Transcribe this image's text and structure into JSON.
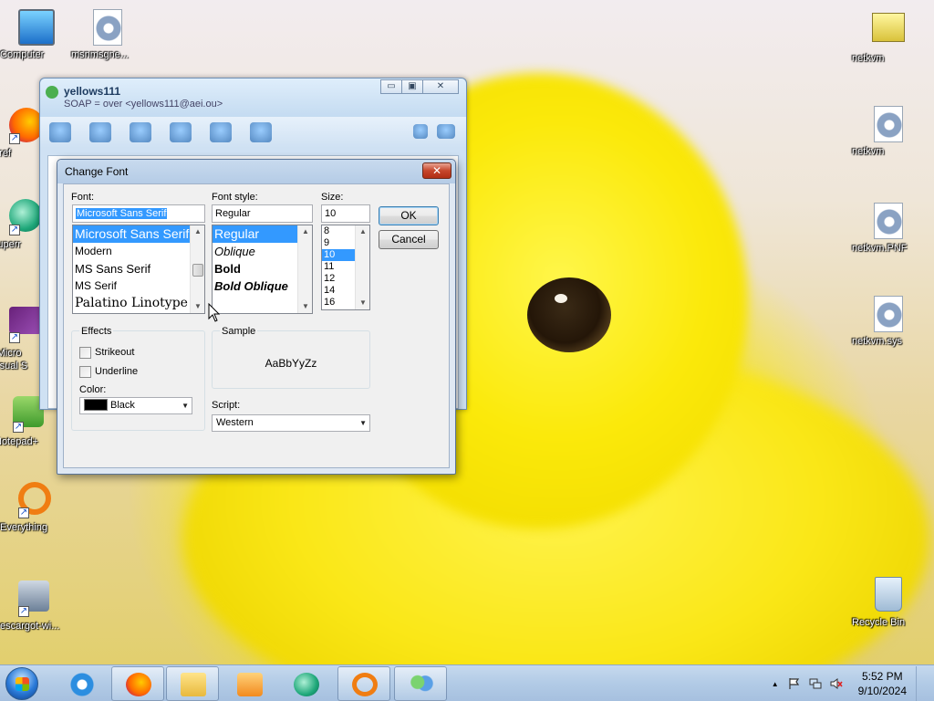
{
  "desktop": {
    "icons_left": [
      {
        "label": "Computer",
        "icon": "computer-icon"
      },
      {
        "label": "msnmsgne...",
        "icon": "gear-file-icon"
      },
      {
        "label": "Firef",
        "icon": "firefox-icon"
      },
      {
        "label": "Superr",
        "icon": "green-app-icon"
      },
      {
        "label": "Micro\nVisual S",
        "icon": "visual-studio-icon"
      },
      {
        "label": "Notepad+",
        "icon": "notepad-icon"
      },
      {
        "label": "Everything",
        "icon": "everything-icon"
      },
      {
        "label": "escargot-wi...",
        "icon": "installer-icon"
      }
    ],
    "icons_right": [
      {
        "label": "netkvm",
        "icon": "printer-icon"
      },
      {
        "label": "netkvm",
        "icon": "gear-file-icon"
      },
      {
        "label": "netkvm.PNF",
        "icon": "gear-file-icon"
      },
      {
        "label": "netkvm.sys",
        "icon": "gear-file-icon"
      },
      {
        "label": "Recycle Bin",
        "icon": "recycle-bin-icon"
      }
    ]
  },
  "messenger": {
    "title": "yellows111",
    "subtitle": "SOAP = over <yellows111@aei.ou>",
    "buttons": {
      "minimize": "▭",
      "maximize": "▣",
      "close": "✕"
    }
  },
  "dialog": {
    "title": "Change Font",
    "close_label": "✕",
    "font": {
      "label": "Font:",
      "value": "Microsoft Sans Serif",
      "items": [
        "Microsoft Sans Serif",
        "Modern",
        "MS Sans Serif",
        "MS Serif",
        "Palatino Linotype"
      ],
      "selected_index": 0
    },
    "font_style": {
      "label": "Font style:",
      "value": "Regular",
      "items": [
        "Regular",
        "Oblique",
        "Bold",
        "Bold Oblique"
      ],
      "selected_index": 0
    },
    "size": {
      "label": "Size:",
      "value": "10",
      "items": [
        "8",
        "9",
        "10",
        "11",
        "12",
        "14",
        "16"
      ],
      "selected_index": 2
    },
    "ok_label": "OK",
    "cancel_label": "Cancel",
    "effects": {
      "title": "Effects",
      "strikeout_label": "Strikeout",
      "strikeout_checked": false,
      "underline_label": "Underline",
      "underline_checked": false,
      "color_label": "Color:",
      "color_value": "Black",
      "color_hex": "#000000"
    },
    "sample": {
      "title": "Sample",
      "text": "AaBbYyZz"
    },
    "script": {
      "label": "Script:",
      "value": "Western"
    }
  },
  "taskbar": {
    "pinned": [
      "internet-explorer-icon",
      "firefox-icon",
      "explorer-icon",
      "media-player-icon",
      "green-app-icon",
      "everything-icon",
      "messenger-icon"
    ],
    "clock_time": "5:52 PM",
    "clock_date": "9/10/2024",
    "tray_up_arrow": "▲"
  }
}
